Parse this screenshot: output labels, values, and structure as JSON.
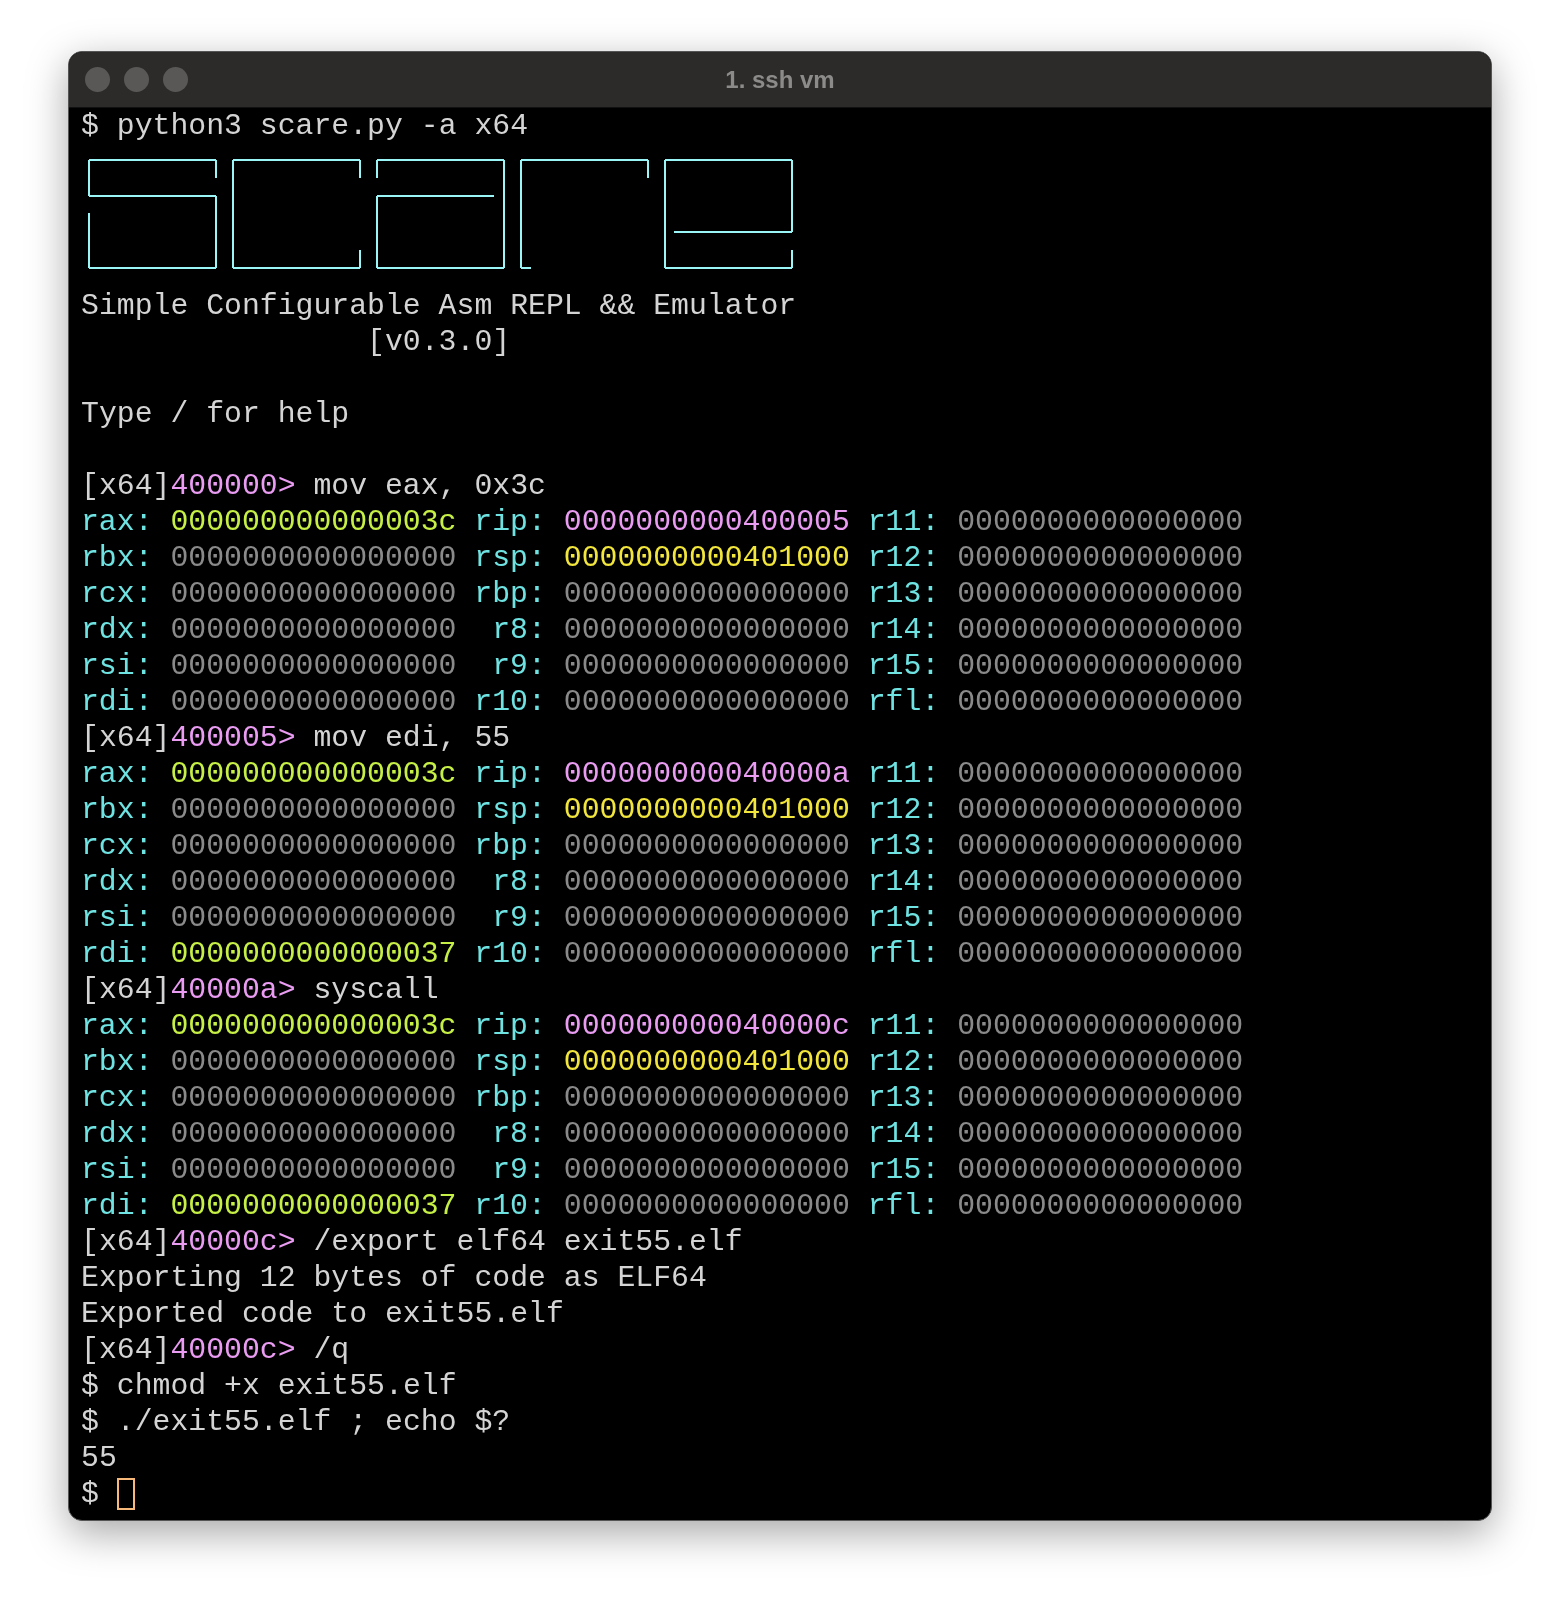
{
  "window": {
    "title": "1. ssh vm"
  },
  "lines": [
    {
      "kind": "command",
      "prompt": "$",
      "text": "python3 scare.py -a x64"
    },
    {
      "kind": "logo"
    },
    {
      "kind": "text",
      "text": "Simple Configurable Asm REPL && Emulator"
    },
    {
      "kind": "indented",
      "text": "[v0.3.0]"
    },
    {
      "kind": "blank"
    },
    {
      "kind": "text",
      "text": "Type / for help"
    },
    {
      "kind": "blank"
    },
    {
      "kind": "repl",
      "arch": "[x64]",
      "address": "400000>",
      "text": "mov eax, 0x3c"
    },
    {
      "kind": "registers",
      "rows": [
        [
          {
            "name": "rax:",
            "value": "000000000000003c",
            "color": "#c6f046"
          },
          {
            "name": "rip:",
            "value": "0000000000400005",
            "color": "#e99cf2"
          },
          {
            "name": "r11:",
            "value": "0000000000000000",
            "color": "#8a8a8a"
          }
        ],
        [
          {
            "name": "rbx:",
            "value": "0000000000000000",
            "color": "#8a8a8a"
          },
          {
            "name": "rsp:",
            "value": "0000000000401000",
            "color": "#f2e63c"
          },
          {
            "name": "r12:",
            "value": "0000000000000000",
            "color": "#8a8a8a"
          }
        ],
        [
          {
            "name": "rcx:",
            "value": "0000000000000000",
            "color": "#8a8a8a"
          },
          {
            "name": "rbp:",
            "value": "0000000000000000",
            "color": "#8a8a8a"
          },
          {
            "name": "r13:",
            "value": "0000000000000000",
            "color": "#8a8a8a"
          }
        ],
        [
          {
            "name": "rdx:",
            "value": "0000000000000000",
            "color": "#8a8a8a"
          },
          {
            "name": "r8:",
            "value": "0000000000000000",
            "color": "#8a8a8a"
          },
          {
            "name": "r14:",
            "value": "0000000000000000",
            "color": "#8a8a8a"
          }
        ],
        [
          {
            "name": "rsi:",
            "value": "0000000000000000",
            "color": "#8a8a8a"
          },
          {
            "name": "r9:",
            "value": "0000000000000000",
            "color": "#8a8a8a"
          },
          {
            "name": "r15:",
            "value": "0000000000000000",
            "color": "#8a8a8a"
          }
        ],
        [
          {
            "name": "rdi:",
            "value": "0000000000000000",
            "color": "#8a8a8a"
          },
          {
            "name": "r10:",
            "value": "0000000000000000",
            "color": "#8a8a8a"
          },
          {
            "name": "rfl:",
            "value": "0000000000000000",
            "color": "#8a8a8a"
          }
        ]
      ]
    },
    {
      "kind": "repl",
      "arch": "[x64]",
      "address": "400005>",
      "text": "mov edi, 55"
    },
    {
      "kind": "registers",
      "rows": [
        [
          {
            "name": "rax:",
            "value": "000000000000003c",
            "color": "#c6f046"
          },
          {
            "name": "rip:",
            "value": "000000000040000a",
            "color": "#e99cf2"
          },
          {
            "name": "r11:",
            "value": "0000000000000000",
            "color": "#8a8a8a"
          }
        ],
        [
          {
            "name": "rbx:",
            "value": "0000000000000000",
            "color": "#8a8a8a"
          },
          {
            "name": "rsp:",
            "value": "0000000000401000",
            "color": "#f2e63c"
          },
          {
            "name": "r12:",
            "value": "0000000000000000",
            "color": "#8a8a8a"
          }
        ],
        [
          {
            "name": "rcx:",
            "value": "0000000000000000",
            "color": "#8a8a8a"
          },
          {
            "name": "rbp:",
            "value": "0000000000000000",
            "color": "#8a8a8a"
          },
          {
            "name": "r13:",
            "value": "0000000000000000",
            "color": "#8a8a8a"
          }
        ],
        [
          {
            "name": "rdx:",
            "value": "0000000000000000",
            "color": "#8a8a8a"
          },
          {
            "name": "r8:",
            "value": "0000000000000000",
            "color": "#8a8a8a"
          },
          {
            "name": "r14:",
            "value": "0000000000000000",
            "color": "#8a8a8a"
          }
        ],
        [
          {
            "name": "rsi:",
            "value": "0000000000000000",
            "color": "#8a8a8a"
          },
          {
            "name": "r9:",
            "value": "0000000000000000",
            "color": "#8a8a8a"
          },
          {
            "name": "r15:",
            "value": "0000000000000000",
            "color": "#8a8a8a"
          }
        ],
        [
          {
            "name": "rdi:",
            "value": "0000000000000037",
            "color": "#c6f046"
          },
          {
            "name": "r10:",
            "value": "0000000000000000",
            "color": "#8a8a8a"
          },
          {
            "name": "rfl:",
            "value": "0000000000000000",
            "color": "#8a8a8a"
          }
        ]
      ]
    },
    {
      "kind": "repl",
      "arch": "[x64]",
      "address": "40000a>",
      "text": "syscall"
    },
    {
      "kind": "registers",
      "rows": [
        [
          {
            "name": "rax:",
            "value": "000000000000003c",
            "color": "#c6f046"
          },
          {
            "name": "rip:",
            "value": "000000000040000c",
            "color": "#e99cf2"
          },
          {
            "name": "r11:",
            "value": "0000000000000000",
            "color": "#8a8a8a"
          }
        ],
        [
          {
            "name": "rbx:",
            "value": "0000000000000000",
            "color": "#8a8a8a"
          },
          {
            "name": "rsp:",
            "value": "0000000000401000",
            "color": "#f2e63c"
          },
          {
            "name": "r12:",
            "value": "0000000000000000",
            "color": "#8a8a8a"
          }
        ],
        [
          {
            "name": "rcx:",
            "value": "0000000000000000",
            "color": "#8a8a8a"
          },
          {
            "name": "rbp:",
            "value": "0000000000000000",
            "color": "#8a8a8a"
          },
          {
            "name": "r13:",
            "value": "0000000000000000",
            "color": "#8a8a8a"
          }
        ],
        [
          {
            "name": "rdx:",
            "value": "0000000000000000",
            "color": "#8a8a8a"
          },
          {
            "name": "r8:",
            "value": "0000000000000000",
            "color": "#8a8a8a"
          },
          {
            "name": "r14:",
            "value": "0000000000000000",
            "color": "#8a8a8a"
          }
        ],
        [
          {
            "name": "rsi:",
            "value": "0000000000000000",
            "color": "#8a8a8a"
          },
          {
            "name": "r9:",
            "value": "0000000000000000",
            "color": "#8a8a8a"
          },
          {
            "name": "r15:",
            "value": "0000000000000000",
            "color": "#8a8a8a"
          }
        ],
        [
          {
            "name": "rdi:",
            "value": "0000000000000037",
            "color": "#c6f046"
          },
          {
            "name": "r10:",
            "value": "0000000000000000",
            "color": "#8a8a8a"
          },
          {
            "name": "rfl:",
            "value": "0000000000000000",
            "color": "#8a8a8a"
          }
        ]
      ]
    },
    {
      "kind": "repl",
      "arch": "[x64]",
      "address": "40000c>",
      "text": "/export elf64 exit55.elf"
    },
    {
      "kind": "text",
      "text": "Exporting 12 bytes of code as ELF64"
    },
    {
      "kind": "text",
      "text": "Exported code to exit55.elf"
    },
    {
      "kind": "repl",
      "arch": "[x64]",
      "address": "40000c>",
      "text": "/q"
    },
    {
      "kind": "command",
      "prompt": "$",
      "text": "chmod +x exit55.elf"
    },
    {
      "kind": "command",
      "prompt": "$",
      "text": "./exit55.elf ; echo $?"
    },
    {
      "kind": "text",
      "text": "55"
    },
    {
      "kind": "cursor",
      "prompt": "$"
    }
  ]
}
